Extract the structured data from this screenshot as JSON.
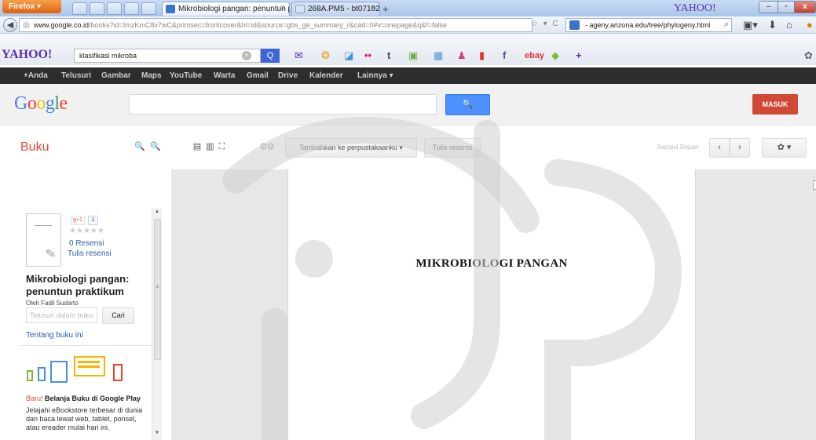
{
  "browser": {
    "firefox_label": "Firefox ▾",
    "tabs": [
      {
        "title": "Mikrobiologi pangan: penuntun prak...",
        "close": "×"
      },
      {
        "title": "268A.PM5 - bt071027.pdf",
        "close": "×"
      }
    ],
    "new_tab": "+",
    "title_yahoo": "YAHOO!",
    "window_controls": {
      "minimize": "–",
      "maximize": "▫",
      "close": "x"
    }
  },
  "navbar": {
    "back_icon": "◀",
    "url_host": "www.google.co.id",
    "url_path": "/books?id=ImzKmC8v7wC&printsec=frontcover&hl=id&source=gbs_ge_summary_r&cad=0#v=onepage&q&f=false",
    "url_icons": "☆ ▾ C",
    "search_text": "- ageny.arizona.edu/tree/phylogeny.html",
    "icons": [
      "▣▾",
      "⬇",
      "⌂"
    ]
  },
  "yahoo_toolbar": {
    "logo": "YAHOO!",
    "search_value": "klasifikasi mikroba",
    "clear": "×",
    "go": "Q",
    "icons": [
      "✉",
      "❂",
      "◪",
      "••",
      "t",
      "▣",
      "▦",
      "♟",
      "▮",
      "f",
      "ebay",
      "◆",
      "+"
    ]
  },
  "gbar": {
    "items": [
      "+Anda",
      "Telusuri",
      "Gambar",
      "Maps",
      "YouTube",
      "Warta",
      "Gmail",
      "Drive",
      "Kalender",
      "Lainnya ▾"
    ]
  },
  "google_header": {
    "logo_letters": [
      "G",
      "o",
      "o",
      "g",
      "l",
      "e"
    ],
    "search_button": "🔍",
    "signin": "MASUK"
  },
  "books_toolbar": {
    "section": "Buku",
    "zoom_out": "🔍",
    "zoom_in": "🔍",
    "view_modes": [
      "▤",
      "▥",
      "⛶"
    ],
    "link": "⊙⊙",
    "add_library": "Tambahkan ke perpustakaanku ▾",
    "write_review": "Tulis resensi",
    "front_cover": "Sampul Depan",
    "prev": "‹",
    "next": "›",
    "settings": "✿ ▾"
  },
  "sidebar": {
    "gplus": "g+1",
    "gplus_count": "1",
    "stars": "★★★★★",
    "reviews": "0 Resensi",
    "write_review": "Tulis resensi",
    "title": "Mikrobiologi pangan: penuntun praktikum",
    "author": "Oleh Fadil Sudarto",
    "inbook_placeholder": "Telusuri dalam buku",
    "inbook_button": "Cari",
    "about": "Tentang buku ini",
    "promo_new": "Baru!",
    "promo_title": "Belanja Buku di Google Play",
    "promo_text": "Jelajahi eBookstore terbesar di dunia dan baca lewat web, tablet, ponsel, atau ereader mulai hari ini."
  },
  "reader": {
    "page_heading": "MIKROBIOLOGI PANGAN"
  },
  "colors": {
    "google_blue": "#4285f4",
    "google_red": "#ea4335",
    "google_yellow": "#fbbc05",
    "google_green": "#34a853",
    "books_red": "#dd4b39",
    "signin_red": "#d14836",
    "link_blue": "#2a5db0",
    "watermark": "#dcdcdc"
  }
}
